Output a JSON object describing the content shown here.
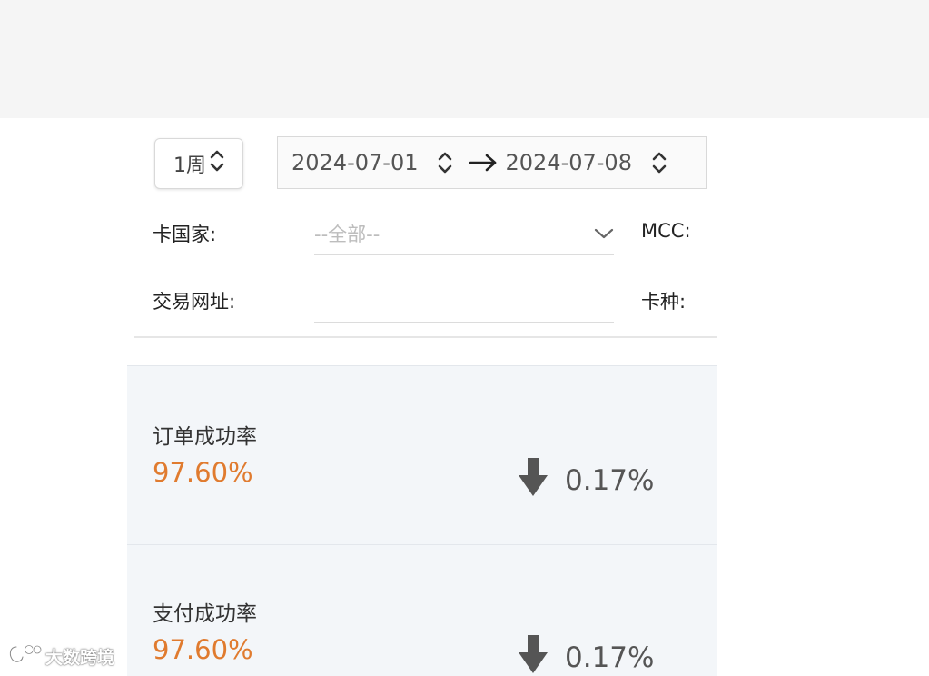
{
  "filters": {
    "period_select": {
      "label": "1周",
      "icon": "up-down-chevron-icon"
    },
    "date_range": {
      "start": "2024-07-01",
      "end": "2024-07-08",
      "separator_icon": "arrow-right-icon"
    },
    "card_country": {
      "label": "卡国家:",
      "placeholder": "--全部--",
      "icon": "chevron-down-icon"
    },
    "mcc": {
      "label": "MCC:"
    },
    "trade_url": {
      "label": "交易网址:",
      "value": ""
    },
    "card_type": {
      "label": "卡种:"
    }
  },
  "metrics": [
    {
      "title": "订单成功率",
      "value": "97.60%",
      "change": "0.17%",
      "trend": "down",
      "icon": "arrow-down-icon"
    },
    {
      "title": "支付成功率",
      "value": "97.60%",
      "change": "0.17%",
      "trend": "down",
      "icon": "arrow-down-icon"
    }
  ],
  "watermark": {
    "text": "大数跨境",
    "icon": "brand-logo-icon"
  },
  "colors": {
    "value_orange": "#e07b2f",
    "card_bg": "#f3f6f9",
    "top_band": "#f5f5f5",
    "trend_icon": "#555555"
  }
}
